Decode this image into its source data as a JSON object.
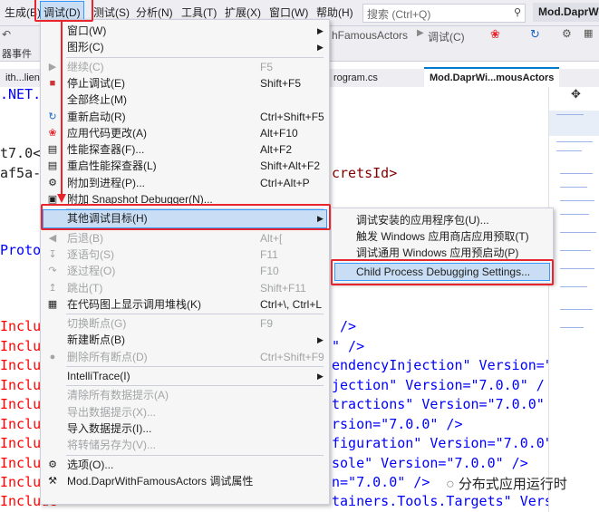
{
  "menubar": {
    "items": [
      "生成(B)",
      "调试(D)",
      "测试(S)",
      "分析(N)",
      "工具(T)",
      "扩展(X)",
      "窗口(W)",
      "帮助(H)"
    ],
    "search_placeholder": "搜索 (Ctrl+Q)",
    "project_title": "Mod.DaprW"
  },
  "toolbar": {
    "frag1": "hFamousActors",
    "debug_label": "调试(C)",
    "frag2": "器事件",
    "frag3": "lie"
  },
  "tabs": {
    "left": "ith...lient.",
    "mid": "rogram.cs",
    "active": "Mod.DaprWi...mousActors"
  },
  "editor": {
    "l1": ".NET.S",
    "l2": "t7.0<",
    "l3": "af5a-",
    "l3b": "cretsId>",
    "l4": "Proto",
    "includes": [
      {
        "pre": "Include",
        "post": " />"
      },
      {
        "pre": "Include",
        "post": "\" />"
      },
      {
        "pre": "Include",
        "post": "endencyInjection\" Version=\""
      },
      {
        "pre": "Include",
        "post": "jection\" Version=\"7.0.0\" /"
      },
      {
        "pre": "Include",
        "post": "tractions\" Version=\"7.0.0\""
      },
      {
        "pre": "Include",
        "post": "rsion=\"7.0.0\" />"
      },
      {
        "pre": "Include",
        "post": "figuration\" Version=\"7.0.0\""
      },
      {
        "pre": "Include",
        "post": "sole\" Version=\"7.0.0\" />"
      },
      {
        "pre": "Include",
        "post": "n=\"7.0.0\" />"
      },
      {
        "pre": "Include",
        "post": "tainers.Tools.Targets\" Vers"
      }
    ]
  },
  "debug_menu": {
    "items": [
      {
        "label": "窗口(W)",
        "shortcut": "",
        "submenu": true,
        "disabled": false,
        "icon": ""
      },
      {
        "label": "图形(C)",
        "shortcut": "",
        "submenu": true,
        "disabled": false,
        "icon": ""
      },
      {
        "label": "继续(C)",
        "shortcut": "F5",
        "submenu": false,
        "disabled": true,
        "icon": "play-icon"
      },
      {
        "label": "停止调试(E)",
        "shortcut": "Shift+F5",
        "submenu": false,
        "disabled": false,
        "icon": "stop-icon"
      },
      {
        "label": "全部终止(M)",
        "shortcut": "",
        "submenu": false,
        "disabled": false,
        "icon": ""
      },
      {
        "label": "重新启动(R)",
        "shortcut": "Ctrl+Shift+F5",
        "submenu": false,
        "disabled": false,
        "icon": "restart-icon"
      },
      {
        "label": "应用代码更改(A)",
        "shortcut": "Alt+F10",
        "submenu": false,
        "disabled": false,
        "icon": "hot-reload-icon"
      },
      {
        "label": "性能探查器(F)...",
        "shortcut": "Alt+F2",
        "submenu": false,
        "disabled": false,
        "icon": "profiler-icon"
      },
      {
        "label": "重启性能探查器(L)",
        "shortcut": "Shift+Alt+F2",
        "submenu": false,
        "disabled": false,
        "icon": "profiler-restart-icon"
      },
      {
        "label": "附加到进程(P)...",
        "shortcut": "Ctrl+Alt+P",
        "submenu": false,
        "disabled": false,
        "icon": "attach-icon"
      },
      {
        "label": "附加 Snapshot Debugger(N)...",
        "shortcut": "",
        "submenu": false,
        "disabled": false,
        "icon": "snapshot-icon"
      },
      {
        "label": "其他调试目标(H)",
        "shortcut": "",
        "submenu": true,
        "disabled": false,
        "icon": ""
      },
      {
        "label": "后退(B)",
        "shortcut": "Alt+[",
        "submenu": false,
        "disabled": true,
        "icon": "step-back-icon"
      },
      {
        "label": "逐语句(S)",
        "shortcut": "F11",
        "submenu": false,
        "disabled": true,
        "icon": "step-into-icon"
      },
      {
        "label": "逐过程(O)",
        "shortcut": "F10",
        "submenu": false,
        "disabled": true,
        "icon": "step-over-icon"
      },
      {
        "label": "跳出(T)",
        "shortcut": "Shift+F11",
        "submenu": false,
        "disabled": true,
        "icon": "step-out-icon"
      },
      {
        "label": "在代码图上显示调用堆栈(K)",
        "shortcut": "Ctrl+\\, Ctrl+L",
        "submenu": false,
        "disabled": false,
        "icon": "code-map-icon"
      },
      {
        "label": "切换断点(G)",
        "shortcut": "F9",
        "submenu": false,
        "disabled": true,
        "icon": ""
      },
      {
        "label": "新建断点(B)",
        "shortcut": "",
        "submenu": true,
        "disabled": false,
        "icon": ""
      },
      {
        "label": "删除所有断点(D)",
        "shortcut": "Ctrl+Shift+F9",
        "submenu": false,
        "disabled": true,
        "icon": "delete-breakpoints-icon"
      },
      {
        "label": "IntelliTrace(I)",
        "shortcut": "",
        "submenu": true,
        "disabled": false,
        "icon": ""
      },
      {
        "label": "清除所有数据提示(A)",
        "shortcut": "",
        "submenu": false,
        "disabled": true,
        "icon": ""
      },
      {
        "label": "导出数据提示(X)...",
        "shortcut": "",
        "submenu": false,
        "disabled": true,
        "icon": ""
      },
      {
        "label": "导入数据提示(I)...",
        "shortcut": "",
        "submenu": false,
        "disabled": false,
        "icon": ""
      },
      {
        "label": "将转储另存为(V)...",
        "shortcut": "",
        "submenu": false,
        "disabled": true,
        "icon": ""
      },
      {
        "label": "选项(O)...",
        "shortcut": "",
        "submenu": false,
        "disabled": false,
        "icon": "gear-icon"
      },
      {
        "label": "Mod.DaprWithFamousActors 调试属性",
        "shortcut": "",
        "submenu": false,
        "disabled": false,
        "icon": "wrench-icon"
      }
    ]
  },
  "sub_menu": {
    "items": [
      "调试安装的应用程序包(U)...",
      "触发 Windows 应用商店应用预取(T)",
      "调试通用 Windows 应用预启动(P)",
      "Child Process Debugging Settings..."
    ]
  },
  "watermark": "分布式应用运行时",
  "colors": {
    "highlight": "#c9def5",
    "highlight_border": "#3399ff",
    "annotation_red": "#e8242d",
    "accent": "#007acc"
  }
}
